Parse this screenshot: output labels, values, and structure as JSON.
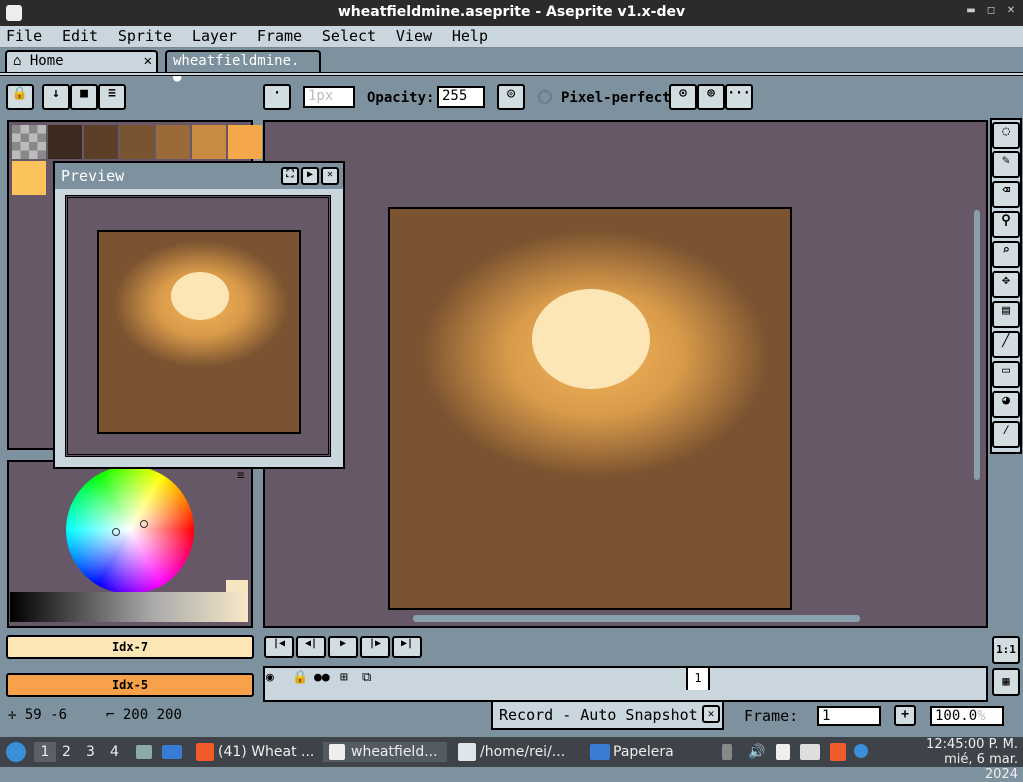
{
  "window": {
    "title": "wheatfieldmine.aseprite - Aseprite v1.x-dev"
  },
  "menu": [
    "File",
    "Edit",
    "Sprite",
    "Layer",
    "Frame",
    "Select",
    "View",
    "Help"
  ],
  "tabs": [
    {
      "label": "Home",
      "close": "✕"
    },
    {
      "label": "wheatfieldmine.",
      "modified": "●"
    }
  ],
  "toolbar": {
    "brush_size": "1px",
    "opacity_label": "Opacity:",
    "opacity_value": "255",
    "pixel_perfect": "Pixel-perfect",
    "more": "···"
  },
  "palette_colors": [
    "#3e2b20",
    "#5b3f27",
    "#7a5330",
    "#9b6a39",
    "#c98a43",
    "#f5a84a",
    "#fcc35c"
  ],
  "preview": {
    "title": "Preview"
  },
  "color_bars": {
    "fg": "Idx-7",
    "bg": "Idx-5",
    "fg_color": "#fde6b6",
    "bg_color": "#f7a14a"
  },
  "status": {
    "coords": "59 -6",
    "size": "200 200",
    "frame_label": "Frame:",
    "frame_value": "1",
    "zoom": "100.0"
  },
  "timeline": {
    "frame_number": "1"
  },
  "notification": {
    "text": "Record - Auto Snapshot"
  },
  "taskbar": {
    "workspaces": [
      "1",
      "2",
      "3",
      "4"
    ],
    "items": [
      "(41) Wheat ...",
      "wheatfield...",
      "/home/rei/...",
      "Papelera"
    ],
    "time": "12:45:00 P. M.",
    "date": "mié, 6 mar. 2024"
  }
}
